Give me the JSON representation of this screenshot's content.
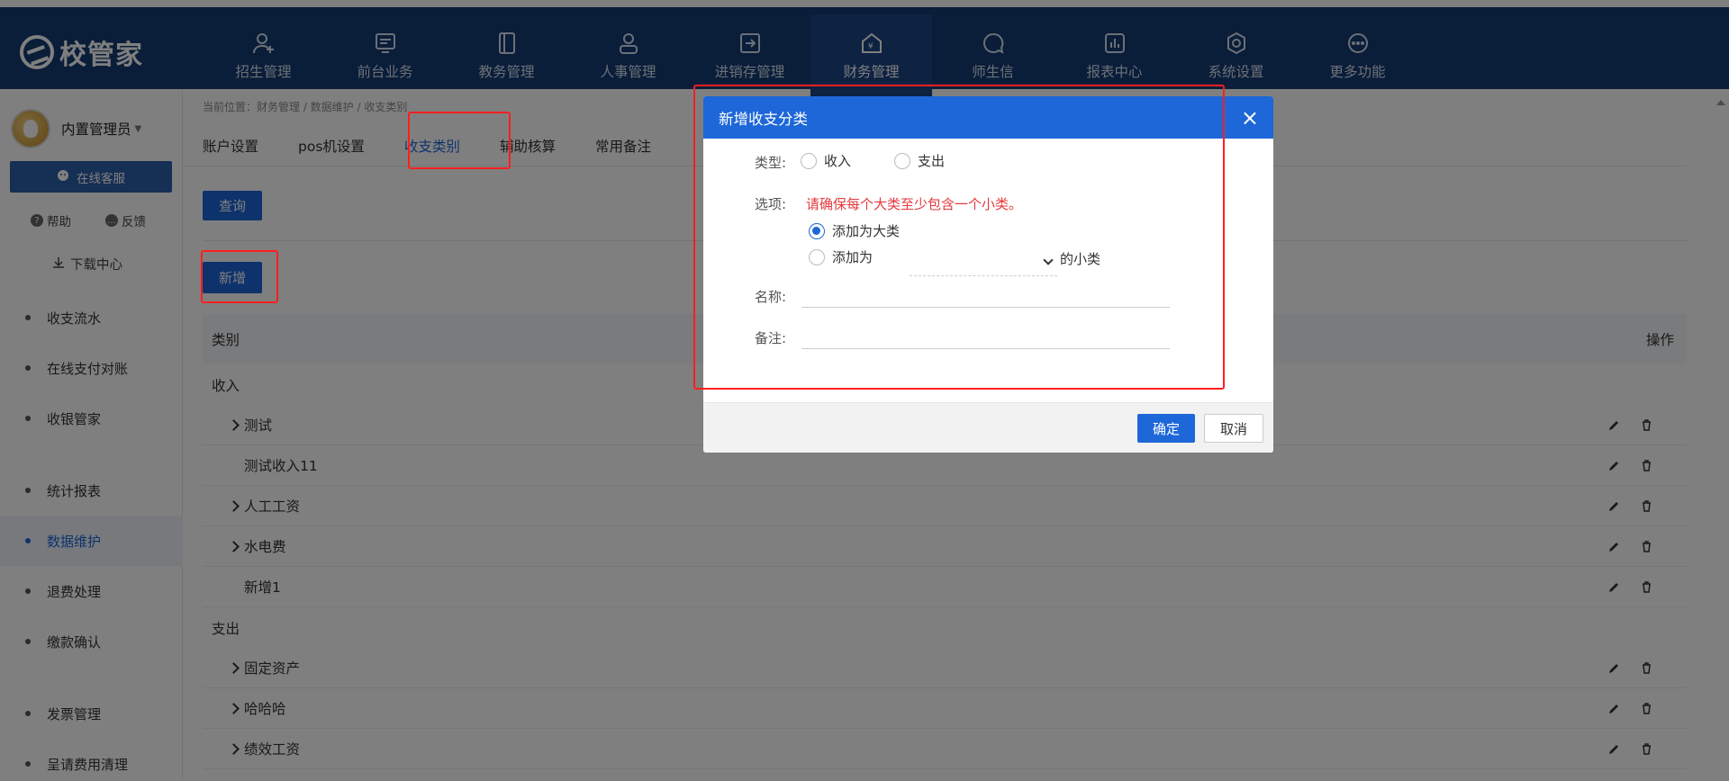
{
  "app": {
    "logo_text": "校管家"
  },
  "nav": [
    {
      "label": "招生管理",
      "icon": "user-plus-icon"
    },
    {
      "label": "前台业务",
      "icon": "monitor-icon"
    },
    {
      "label": "教务管理",
      "icon": "book-icon"
    },
    {
      "label": "人事管理",
      "icon": "person-icon"
    },
    {
      "label": "进销存管理",
      "icon": "inventory-icon"
    },
    {
      "label": "财务管理",
      "icon": "finance-house-icon",
      "active": true
    },
    {
      "label": "师生信",
      "icon": "chat-icon"
    },
    {
      "label": "报表中心",
      "icon": "chart-icon"
    },
    {
      "label": "系统设置",
      "icon": "gear-icon"
    },
    {
      "label": "更多功能",
      "icon": "more-icon"
    }
  ],
  "sidebar": {
    "user_name": "内置管理员",
    "online_service": "在线客服",
    "help": "帮助",
    "feedback": "反馈",
    "download_center": "下载中心",
    "menu": [
      {
        "label": "收支流水"
      },
      {
        "label": "在线支付对账"
      },
      {
        "label": "收银管家"
      },
      {
        "label": "统计报表"
      },
      {
        "label": "数据维护",
        "active": true
      },
      {
        "label": "退费处理"
      },
      {
        "label": "缴款确认"
      },
      {
        "label": "发票管理"
      },
      {
        "label": "呈请费用清理"
      }
    ]
  },
  "main": {
    "breadcrumb": "当前位置：财务管理 / 数据维护 / 收支类别",
    "tabs": [
      {
        "label": "账户设置"
      },
      {
        "label": "pos机设置"
      },
      {
        "label": "收支类别",
        "active": true
      },
      {
        "label": "辅助核算"
      },
      {
        "label": "常用备注"
      }
    ],
    "query_label": "查询",
    "new_label": "新增",
    "table": {
      "col_category": "类别",
      "col_ops": "操作",
      "rows": [
        {
          "label": "收入",
          "level": 0,
          "group": true
        },
        {
          "label": "测试",
          "level": 1,
          "expandable": true
        },
        {
          "label": "测试收入11",
          "level": 2
        },
        {
          "label": "人工工资",
          "level": 1,
          "expandable": true
        },
        {
          "label": "水电费",
          "level": 1,
          "expandable": true
        },
        {
          "label": "新增1",
          "level": 2
        },
        {
          "label": "支出",
          "level": 0,
          "group": true
        },
        {
          "label": "固定资产",
          "level": 1,
          "expandable": true
        },
        {
          "label": "哈哈哈",
          "level": 1,
          "expandable": true
        },
        {
          "label": "绩效工资",
          "level": 1,
          "expandable": true
        }
      ]
    }
  },
  "modal": {
    "title": "新增收支分类",
    "close_glyph": "×",
    "type_label": "类型:",
    "type_income": "收入",
    "type_expense": "支出",
    "option_label": "选项:",
    "warning": "请确保每个大类至少包含一个小类。",
    "add_as_major": "添加为大类",
    "add_as": "添加为",
    "subcategory_suffix": "的小类",
    "name_label": "名称:",
    "note_label": "备注:",
    "ok_label": "确定",
    "cancel_label": "取消"
  },
  "colors": {
    "header_bg": "#143a73",
    "accent": "#1d67d8",
    "warning": "#e4393c",
    "annotation": "#ff1f1f"
  }
}
